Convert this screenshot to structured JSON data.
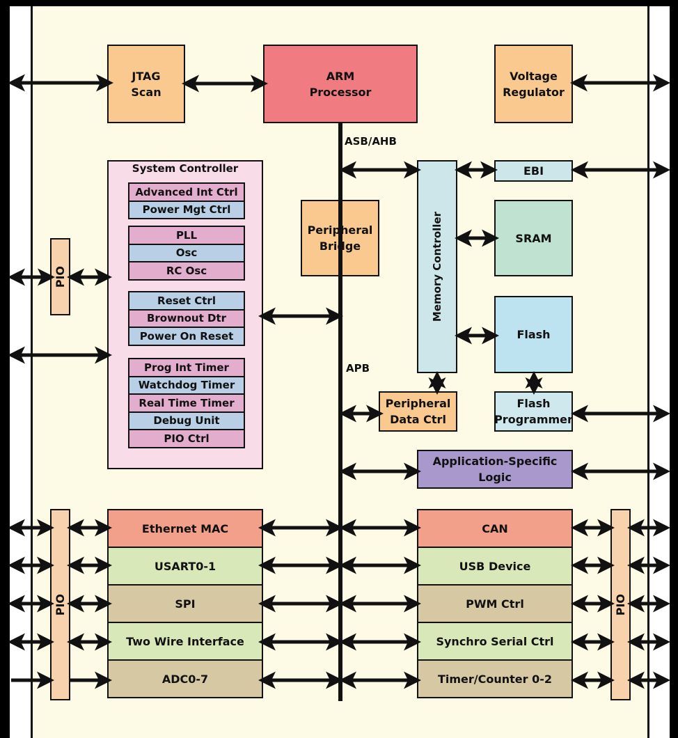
{
  "diagram": {
    "colors": {
      "background": "#fdfae6",
      "orange": "#f9c98f",
      "arm": "#f07b80",
      "system_controller": "#f8dde9",
      "sc_pink": "#e3aece",
      "sc_blue": "#b8cfe6",
      "memory_controller": "#cde6ea",
      "ebi": "#cde6ea",
      "sram": "#bfe3d0",
      "flash": "#bde2f0",
      "flash_programmer": "#cfe8ee",
      "asl": "#a898cc",
      "salmon": "#f3a08a",
      "light_green": "#d9e8b8",
      "tan": "#d6c8a2",
      "pio": "#f8d2ac"
    },
    "blocks": {
      "jtag": "JTAG\nScan",
      "arm": "ARM\nProcessor",
      "voltage_regulator": "Voltage\nRegulator",
      "peripheral_bridge": "Peripheral\nBridge",
      "memory_controller": "Memory Controller",
      "ebi": "EBI",
      "sram": "SRAM",
      "flash": "Flash",
      "peripheral_data_ctrl": "Peripheral\nData Ctrl",
      "flash_programmer": "Flash\nProgrammer",
      "application_specific_logic": "Application-Specific\nLogic",
      "pio": "PIO"
    },
    "buses": {
      "asb_ahb": "ASB/AHB",
      "apb": "APB"
    },
    "system_controller": {
      "title": "System Controller",
      "groups": [
        [
          {
            "label": "Advanced Int Ctrl",
            "tone": "pink"
          },
          {
            "label": "Power Mgt Ctrl",
            "tone": "blue"
          }
        ],
        [
          {
            "label": "PLL",
            "tone": "pink"
          },
          {
            "label": "Osc",
            "tone": "blue"
          },
          {
            "label": "RC Osc",
            "tone": "pink"
          }
        ],
        [
          {
            "label": "Reset Ctrl",
            "tone": "blue"
          },
          {
            "label": "Brownout Dtr",
            "tone": "pink"
          },
          {
            "label": "Power On Reset",
            "tone": "blue"
          }
        ],
        [
          {
            "label": "Prog Int Timer",
            "tone": "pink"
          },
          {
            "label": "Watchdog Timer",
            "tone": "blue"
          },
          {
            "label": "Real Time Timer",
            "tone": "pink"
          },
          {
            "label": "Debug Unit",
            "tone": "blue"
          },
          {
            "label": "PIO Ctrl",
            "tone": "pink"
          }
        ]
      ]
    },
    "left_peripherals": [
      {
        "label": "Ethernet MAC",
        "tone": "salmon"
      },
      {
        "label": "USART0-1",
        "tone": "green"
      },
      {
        "label": "SPI",
        "tone": "tan"
      },
      {
        "label": "Two Wire Interface",
        "tone": "green"
      },
      {
        "label": "ADC0-7",
        "tone": "tan"
      }
    ],
    "right_peripherals": [
      {
        "label": "CAN",
        "tone": "salmon"
      },
      {
        "label": "USB Device",
        "tone": "green"
      },
      {
        "label": "PWM Ctrl",
        "tone": "tan"
      },
      {
        "label": "Synchro Serial Ctrl",
        "tone": "green"
      },
      {
        "label": "Timer/Counter 0-2",
        "tone": "tan"
      }
    ]
  }
}
